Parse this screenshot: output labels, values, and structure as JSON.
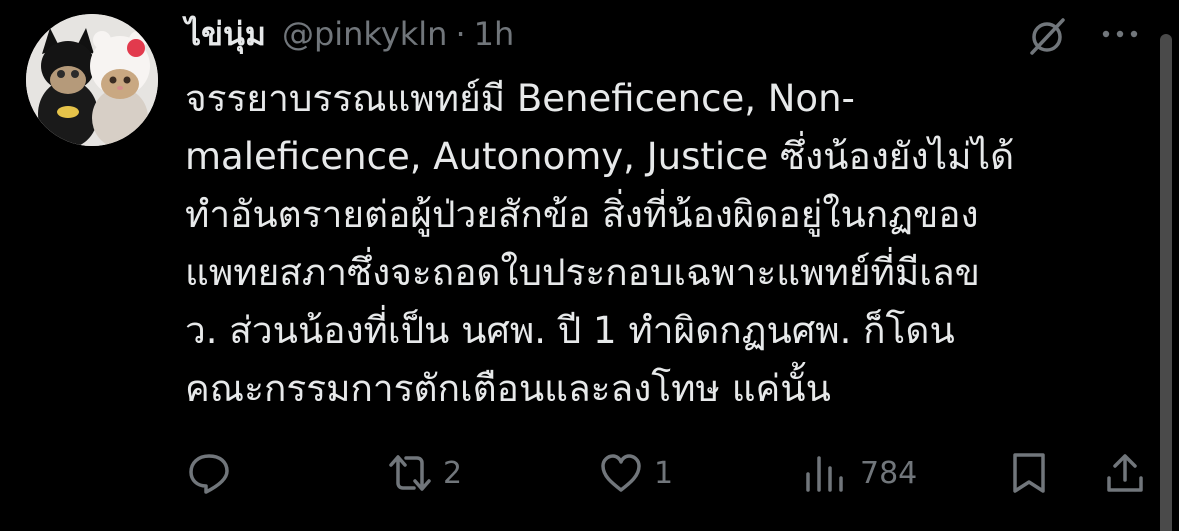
{
  "author": {
    "display_name": "ไข่นุ่ม",
    "handle": "@pinkykln",
    "separator": "·",
    "time": "1h"
  },
  "tweet": {
    "lines": [
      "จรรยาบรรณแพทย์มี Beneficence, Non-",
      "maleficence, Autonomy, Justice ซึ่งน้องยังไม่ได้",
      "ทำอันตรายต่อผู้ป่วยสักข้อ สิ่งที่น้องผิดอยู่ในกฏของ",
      "แพทยสภาซึ่งจะถอดใบประกอบเฉพาะแพทย์ที่มีเลข",
      "ว. ส่วนน้องที่เป็น นศพ. ปี 1 ทำผิดกฏนศพ. ก็โดน",
      "คณะกรรมการตักเตือนและลงโทษ แค่นั้น"
    ]
  },
  "actions": {
    "reply_icon": "reply-icon",
    "retweet_icon": "retweet-icon",
    "retweet_count": "2",
    "like_icon": "heart-icon",
    "like_count": "1",
    "views_icon": "views-icon",
    "views_count": "784",
    "bookmark_icon": "bookmark-icon",
    "share_icon": "share-icon"
  },
  "header_icons": {
    "grok": "grok-icon",
    "more": "more-icon"
  },
  "colors": {
    "background": "#000000",
    "text": "#e7e9ea",
    "secondary": "#71767b"
  }
}
